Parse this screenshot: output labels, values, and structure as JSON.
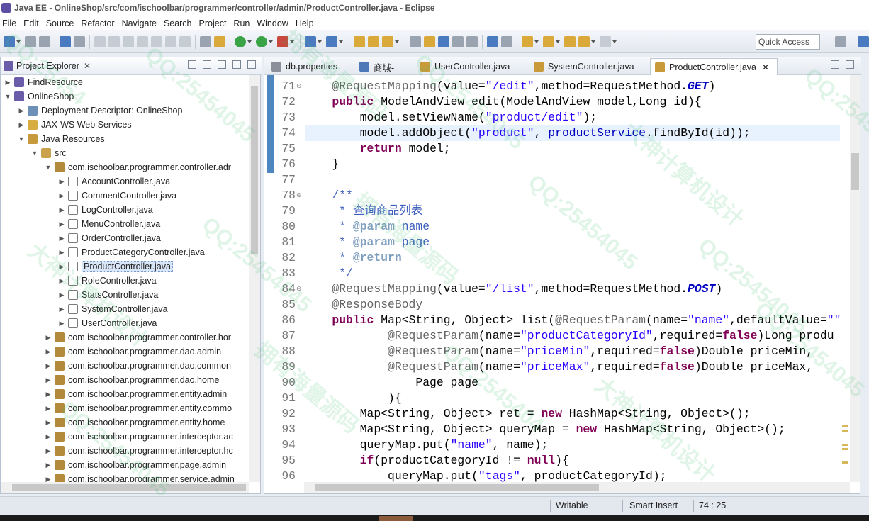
{
  "window": {
    "title": "Java EE - OnlineShop/src/com/ischoolbar/programmer/controller/admin/ProductController.java - Eclipse"
  },
  "menu": [
    "File",
    "Edit",
    "Source",
    "Refactor",
    "Navigate",
    "Search",
    "Project",
    "Run",
    "Window",
    "Help"
  ],
  "toolbar": {
    "quick_access": "Quick Access"
  },
  "explorer": {
    "title": "Project Explorer",
    "close": "✕",
    "items": [
      {
        "label": "FindResource",
        "depth": 0,
        "arrow": "▶",
        "icon": "project-icon"
      },
      {
        "label": "OnlineShop",
        "depth": 0,
        "arrow": "▼",
        "icon": "project-icon"
      },
      {
        "label": "Deployment Descriptor: OnlineShop",
        "depth": 1,
        "arrow": "▶",
        "icon": "deployment-descriptor-icon"
      },
      {
        "label": "JAX-WS Web Services",
        "depth": 1,
        "arrow": "▶",
        "icon": "web-services-icon"
      },
      {
        "label": "Java Resources",
        "depth": 1,
        "arrow": "▼",
        "icon": "java-resources-icon"
      },
      {
        "label": "src",
        "depth": 2,
        "arrow": "▼",
        "icon": "source-folder-icon"
      },
      {
        "label": "com.ischoolbar.programmer.controller.adr",
        "depth": 3,
        "arrow": "▼",
        "icon": "package-icon"
      },
      {
        "label": "AccountController.java",
        "depth": 4,
        "arrow": "▶",
        "icon": "java-file-icon"
      },
      {
        "label": "CommentController.java",
        "depth": 4,
        "arrow": "▶",
        "icon": "java-file-icon"
      },
      {
        "label": "LogController.java",
        "depth": 4,
        "arrow": "▶",
        "icon": "java-file-icon"
      },
      {
        "label": "MenuController.java",
        "depth": 4,
        "arrow": "▶",
        "icon": "java-file-icon"
      },
      {
        "label": "OrderController.java",
        "depth": 4,
        "arrow": "▶",
        "icon": "java-file-icon"
      },
      {
        "label": "ProductCategoryController.java",
        "depth": 4,
        "arrow": "▶",
        "icon": "java-file-icon"
      },
      {
        "label": "ProductController.java",
        "depth": 4,
        "arrow": "▶",
        "icon": "java-file-icon",
        "selected": true
      },
      {
        "label": "RoleController.java",
        "depth": 4,
        "arrow": "▶",
        "icon": "java-file-icon"
      },
      {
        "label": "StatsController.java",
        "depth": 4,
        "arrow": "▶",
        "icon": "java-file-icon"
      },
      {
        "label": "SystemController.java",
        "depth": 4,
        "arrow": "▶",
        "icon": "java-file-icon"
      },
      {
        "label": "UserController.java",
        "depth": 4,
        "arrow": "▶",
        "icon": "java-file-icon"
      },
      {
        "label": "com.ischoolbar.programmer.controller.hor",
        "depth": 3,
        "arrow": "▶",
        "icon": "package-icon"
      },
      {
        "label": "com.ischoolbar.programmer.dao.admin",
        "depth": 3,
        "arrow": "▶",
        "icon": "package-icon"
      },
      {
        "label": "com.ischoolbar.programmer.dao.common",
        "depth": 3,
        "arrow": "▶",
        "icon": "package-icon"
      },
      {
        "label": "com.ischoolbar.programmer.dao.home",
        "depth": 3,
        "arrow": "▶",
        "icon": "package-icon"
      },
      {
        "label": "com.ischoolbar.programmer.entity.admin",
        "depth": 3,
        "arrow": "▶",
        "icon": "package-icon"
      },
      {
        "label": "com.ischoolbar.programmer.entity.commo",
        "depth": 3,
        "arrow": "▶",
        "icon": "package-icon"
      },
      {
        "label": "com.ischoolbar.programmer.entity.home",
        "depth": 3,
        "arrow": "▶",
        "icon": "package-icon"
      },
      {
        "label": "com.ischoolbar.programmer.interceptor.ac",
        "depth": 3,
        "arrow": "▶",
        "icon": "package-icon"
      },
      {
        "label": "com.ischoolbar.programmer.interceptor.hc",
        "depth": 3,
        "arrow": "▶",
        "icon": "package-icon"
      },
      {
        "label": "com.ischoolbar.programmer.page.admin",
        "depth": 3,
        "arrow": "▶",
        "icon": "package-icon"
      },
      {
        "label": "com.ischoolbar.programmer.service.admin",
        "depth": 3,
        "arrow": "▶",
        "icon": "package-icon"
      }
    ]
  },
  "editor": {
    "tabs": [
      {
        "label": "db.properties",
        "icon": "properties-file-icon"
      },
      {
        "label": "商城-",
        "icon": "browser-icon"
      },
      {
        "label": "UserController.java",
        "icon": "java-file-icon"
      },
      {
        "label": "SystemController.java",
        "icon": "java-file-icon"
      },
      {
        "label": "ProductController.java",
        "icon": "java-file-icon",
        "active": true,
        "close": "✕"
      }
    ],
    "lines": [
      {
        "n": "71",
        "fold": "⊖",
        "html": "    <span class=\"a\">@RequestMapping</span>(value=<span class=\"s\">\"/edit\"</span>,method=RequestMethod.<span class=\"v i\">GET</span>)"
      },
      {
        "n": "72",
        "html": "    <span class=\"k\">public</span> ModelAndView edit(ModelAndView model,Long id){"
      },
      {
        "n": "73",
        "html": "        model.setViewName(<span class=\"s\">\"product/edit\"</span>);"
      },
      {
        "n": "74",
        "html": "        model.addObject(<span class=\"s\">\"product\"</span>, <span class=\"v\">productService</span>.findById(id));"
      },
      {
        "n": "75",
        "html": "        <span class=\"k\">return</span> model;"
      },
      {
        "n": "76",
        "html": "    }"
      },
      {
        "n": "77",
        "html": ""
      },
      {
        "n": "78",
        "fold": "⊖",
        "html": "    <span class=\"c\">/**</span>"
      },
      {
        "n": "79",
        "html": "<span class=\"c\">     * 查询商品列表</span>"
      },
      {
        "n": "80",
        "html": "<span class=\"c\">     * </span><span class=\"t\">@param</span><span class=\"c\"> name</span>"
      },
      {
        "n": "81",
        "html": "<span class=\"c\">     * </span><span class=\"t\">@param</span><span class=\"c\"> page</span>"
      },
      {
        "n": "82",
        "html": "<span class=\"c\">     * </span><span class=\"t\">@return</span>"
      },
      {
        "n": "83",
        "html": "<span class=\"c\">     */</span>"
      },
      {
        "n": "84",
        "fold": "⊖",
        "html": "    <span class=\"a\">@RequestMapping</span>(value=<span class=\"s\">\"/list\"</span>,method=RequestMethod.<span class=\"v i\">POST</span>)"
      },
      {
        "n": "85",
        "html": "    <span class=\"a\">@ResponseBody</span>"
      },
      {
        "n": "86",
        "html": "    <span class=\"k\">public</span> Map&lt;String, Object&gt; list(<span class=\"a\">@RequestParam</span>(name=<span class=\"s\">\"name\"</span>,defaultValue=<span class=\"s\">\"\"</span>"
      },
      {
        "n": "87",
        "html": "            <span class=\"a\">@RequestParam</span>(name=<span class=\"s\">\"productCategoryId\"</span>,required=<span class=\"k\">false</span>)Long produ"
      },
      {
        "n": "88",
        "html": "            <span class=\"a\">@RequestParam</span>(name=<span class=\"s\">\"priceMin\"</span>,required=<span class=\"k\">false</span>)Double priceMin,"
      },
      {
        "n": "89",
        "html": "            <span class=\"a\">@RequestParam</span>(name=<span class=\"s\">\"priceMax\"</span>,required=<span class=\"k\">false</span>)Double priceMax,"
      },
      {
        "n": "90",
        "html": "                Page page"
      },
      {
        "n": "91",
        "html": "            ){"
      },
      {
        "n": "92",
        "html": "        Map&lt;String, Object&gt; ret = <span class=\"k\">new</span> HashMap&lt;String, Object&gt;();"
      },
      {
        "n": "93",
        "html": "        Map&lt;String, Object&gt; queryMap = <span class=\"k\">new</span> HashMap&lt;String, Object&gt;();"
      },
      {
        "n": "94",
        "html": "        queryMap.put(<span class=\"s\">\"name\"</span>, name);"
      },
      {
        "n": "95",
        "html": "        <span class=\"k\">if</span>(productCategoryId != <span class=\"k\">null</span>){"
      },
      {
        "n": "96",
        "html": "            queryMap.put(<span class=\"s\">\"tags\"</span>, productCategoryId);"
      }
    ]
  },
  "status": {
    "writable": "Writable",
    "insert_mode": "Smart Insert",
    "position": "74 : 25"
  },
  "watermarks": [
    "QQ:25454",
    "QQ:25454045",
    "拥有海量源码",
    "QQ:25454045",
    "大神计算机设计",
    "QQ:25454045",
    "拥有海量源码",
    "QQ:25454045",
    "大神计算机设计",
    "QQ:25454045",
    "QQ:25454045",
    "拥有海量源码",
    "QQ:2545404",
    "大神计算机设计",
    "QQ:25454045",
    "QQ:25454045"
  ],
  "colors": {
    "keyword": "#7f0055",
    "string": "#2a00ff",
    "annotation": "#646464",
    "comment": "#3f5fbf",
    "current_line": "#e8f2fe",
    "selection_bar": "#4e86c0"
  }
}
